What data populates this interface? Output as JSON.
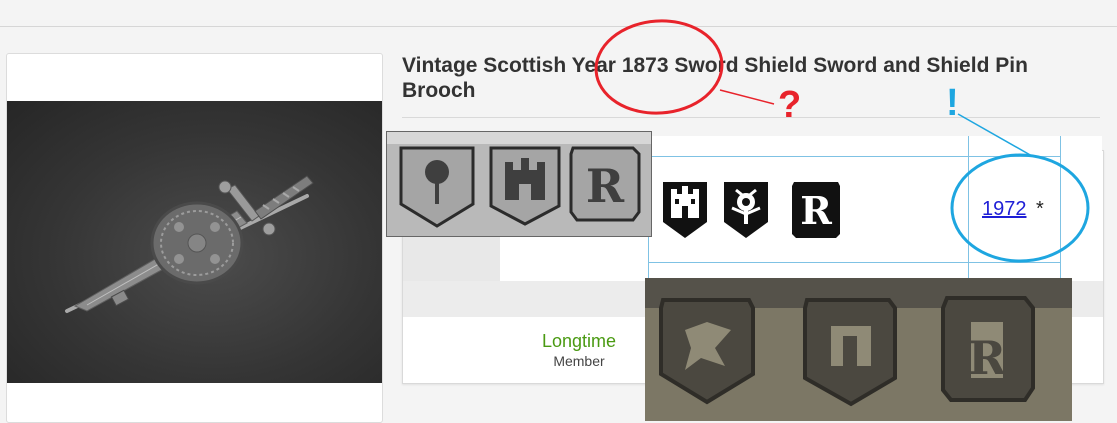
{
  "listing": {
    "title": "Vintage Scottish Year 1873 Sword Shield Sword and Shield Pin Brooch"
  },
  "member": {
    "status": "Longtime",
    "role": "Member"
  },
  "hallmark_chart": {
    "marks": [
      "castle-mark-icon",
      "thistle-mark-icon",
      "letter-r-date-mark-icon"
    ],
    "year": "1972",
    "asterisk": "*"
  },
  "annotations": {
    "question_mark": "?",
    "exclamation_mark": "!",
    "red_color": "#e8232b",
    "blue_color": "#1ea6e0"
  },
  "colors": {
    "status_green": "#4a9a12",
    "link_blue": "#1f1fd6"
  }
}
